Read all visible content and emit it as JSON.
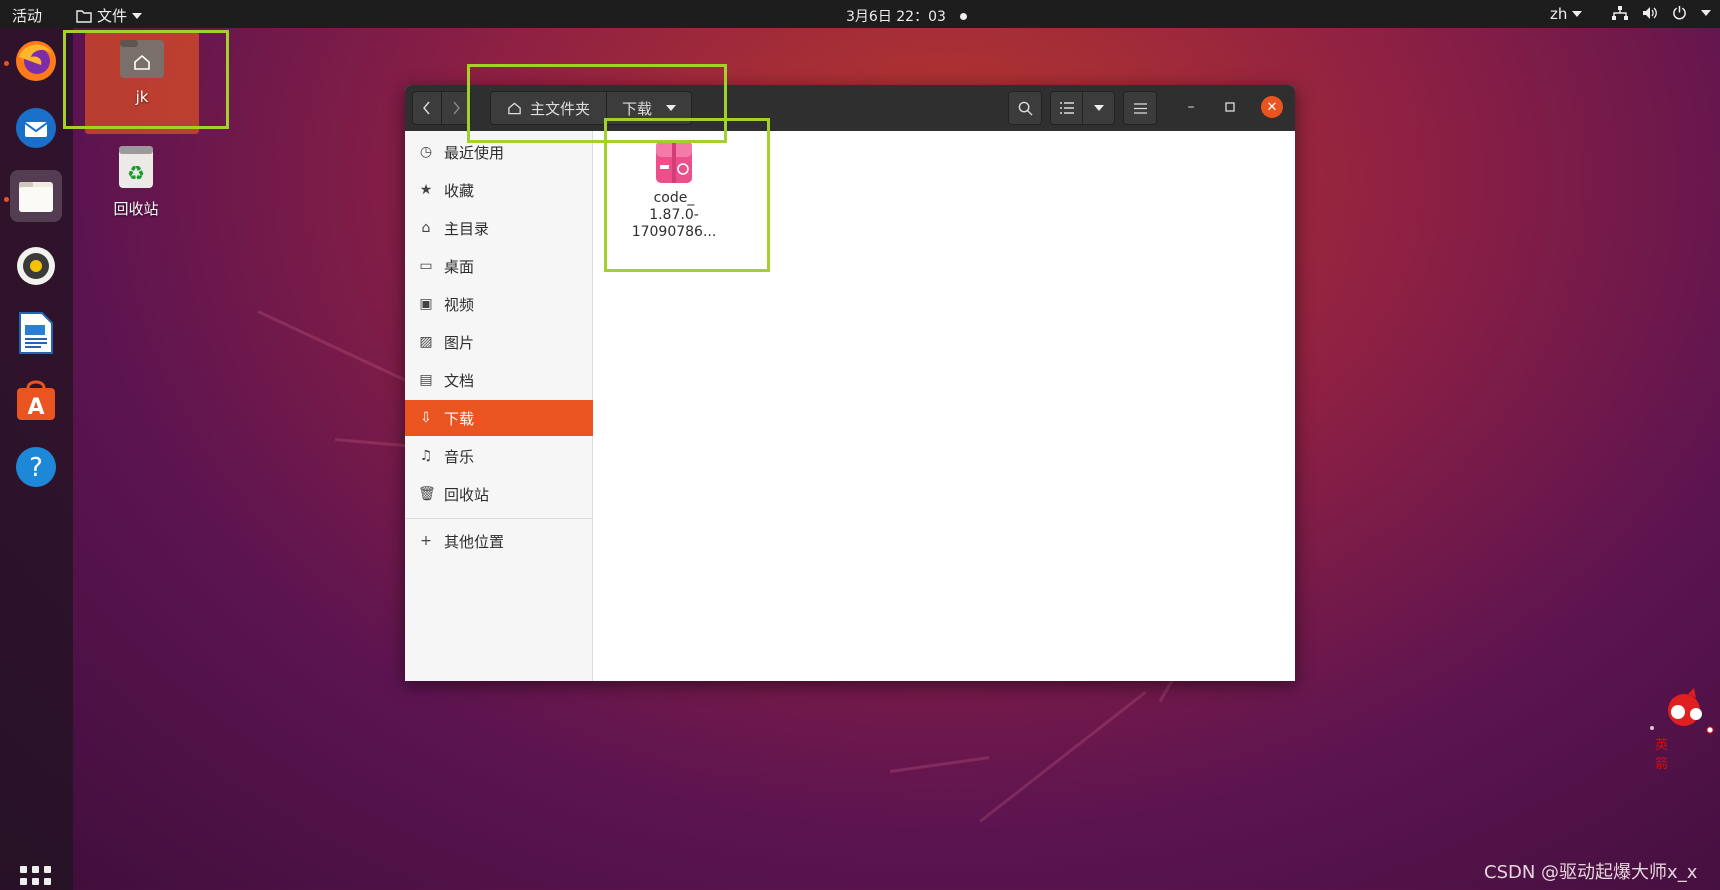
{
  "topbar": {
    "activities": "活动",
    "app_menu": "文件",
    "clock": "3月6日  22：03",
    "language": "zh"
  },
  "dock": {
    "items": [
      "firefox",
      "thunderbird",
      "files",
      "rhythmbox",
      "libreoffice-writer",
      "ubuntu-software",
      "help"
    ]
  },
  "desktop": {
    "home_label": "jk",
    "trash_label": "回收站"
  },
  "window": {
    "pathbar": {
      "home": "主文件夹",
      "current": "下载"
    },
    "sidebar": {
      "items": [
        {
          "label": "最近使用",
          "icon": "clock-icon"
        },
        {
          "label": "收藏",
          "icon": "star-icon"
        },
        {
          "label": "主目录",
          "icon": "home-icon"
        },
        {
          "label": "桌面",
          "icon": "desktop-icon"
        },
        {
          "label": "视频",
          "icon": "video-icon"
        },
        {
          "label": "图片",
          "icon": "image-icon"
        },
        {
          "label": "文档",
          "icon": "document-icon"
        },
        {
          "label": "下载",
          "icon": "download-icon"
        },
        {
          "label": "音乐",
          "icon": "music-icon"
        },
        {
          "label": "回收站",
          "icon": "trash-icon"
        }
      ],
      "other_locations": "其他位置",
      "active": "下载"
    },
    "files": [
      {
        "name_line1": "code_",
        "name_line2": "1.87.0-",
        "name_line3": "17090786..."
      }
    ]
  },
  "mascot_text": "英 箭",
  "watermark": "CSDN @驱动起爆大师x_x",
  "colors": {
    "accent": "#e95420",
    "highlight": "#a3d12c",
    "topbar": "#1d1d1d",
    "headerbar": "#2f2f2f"
  }
}
